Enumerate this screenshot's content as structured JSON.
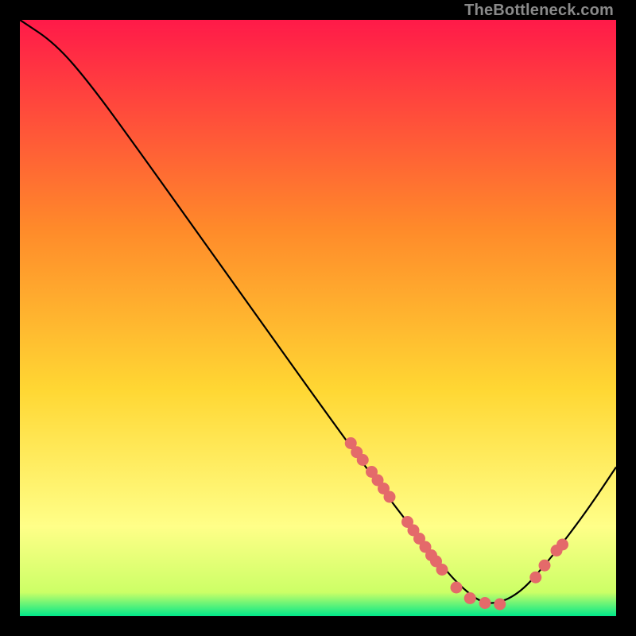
{
  "watermark": "TheBottleneck.com",
  "colors": {
    "grad_top": "#ff1a49",
    "grad_mid1": "#ff6a2a",
    "grad_mid2": "#ffd733",
    "grad_mid3": "#ffff66",
    "grad_bottom": "#00e88a",
    "curve": "#000000",
    "dot": "#e46a6a"
  },
  "chart_data": {
    "type": "line",
    "title": "",
    "xlabel": "",
    "ylabel": "",
    "xlim": [
      0,
      100
    ],
    "ylim": [
      0,
      100
    ],
    "curve_x": [
      0,
      6,
      12,
      20,
      30,
      40,
      50,
      58,
      64,
      68,
      72,
      74.5,
      77,
      80,
      84,
      88,
      92,
      96,
      100
    ],
    "curve_y": [
      100,
      96,
      89,
      78,
      64,
      50,
      36,
      25,
      17,
      12,
      7,
      4.5,
      2.5,
      2,
      4,
      8.5,
      13.5,
      19,
      25
    ],
    "dots": [
      {
        "x": 55.5,
        "y": 29.0
      },
      {
        "x": 56.5,
        "y": 27.5
      },
      {
        "x": 57.5,
        "y": 26.2
      },
      {
        "x": 59.0,
        "y": 24.2
      },
      {
        "x": 60.0,
        "y": 22.8
      },
      {
        "x": 61.0,
        "y": 21.4
      },
      {
        "x": 62.0,
        "y": 20.0
      },
      {
        "x": 65.0,
        "y": 15.8
      },
      {
        "x": 66.0,
        "y": 14.4
      },
      {
        "x": 67.0,
        "y": 13.0
      },
      {
        "x": 68.0,
        "y": 11.6
      },
      {
        "x": 69.0,
        "y": 10.2
      },
      {
        "x": 69.8,
        "y": 9.2
      },
      {
        "x": 70.8,
        "y": 7.8
      },
      {
        "x": 73.2,
        "y": 4.8
      },
      {
        "x": 75.5,
        "y": 3.0
      },
      {
        "x": 78.0,
        "y": 2.2
      },
      {
        "x": 80.5,
        "y": 2.0
      },
      {
        "x": 86.5,
        "y": 6.5
      },
      {
        "x": 88.0,
        "y": 8.5
      },
      {
        "x": 90.0,
        "y": 11.0
      },
      {
        "x": 91.0,
        "y": 12.0
      }
    ]
  }
}
